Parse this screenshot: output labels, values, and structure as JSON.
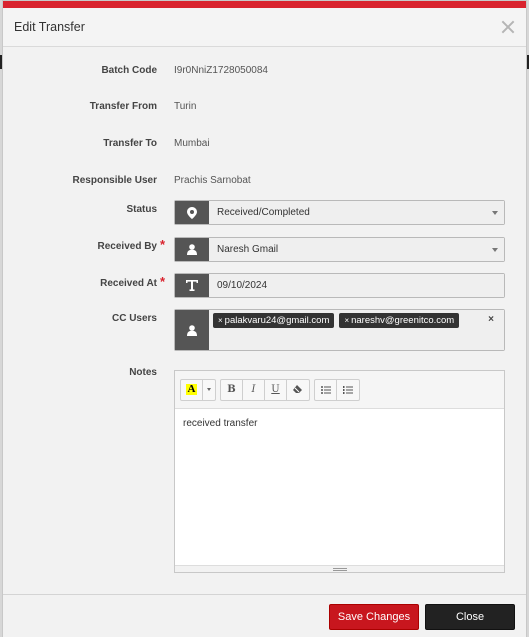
{
  "modal": {
    "title": "Edit Transfer",
    "accent_color": "#d9232e"
  },
  "fields": {
    "batch_code": {
      "label": "Batch Code",
      "value": "I9r0NniZ1728050084"
    },
    "transfer_from": {
      "label": "Transfer From",
      "value": "Turin"
    },
    "transfer_to": {
      "label": "Transfer To",
      "value": "Mumbai"
    },
    "responsible_user": {
      "label": "Responsible User",
      "value": "Prachis Sarnobat"
    },
    "status": {
      "label": "Status",
      "value": "Received/Completed",
      "icon": "map-marker-icon"
    },
    "received_by": {
      "label": "Received By",
      "required_mark": "*",
      "value": "Naresh Gmail",
      "icon": "user-icon"
    },
    "received_at": {
      "label": "Received At",
      "required_mark": "*",
      "value": "09/10/2024",
      "icon": "text-icon"
    },
    "cc_users": {
      "label": "CC Users",
      "icon": "user-icon",
      "chip_remove": "×",
      "clear_all": "×",
      "chips": [
        "palakvaru24@gmail.com",
        "nareshv@greenitco.com"
      ]
    },
    "notes": {
      "label": "Notes",
      "content": "received transfer",
      "toolbar": {
        "color_label": "A",
        "bold": "B",
        "italic": "I",
        "underline": "U"
      }
    }
  },
  "footer": {
    "save_label": "Save Changes",
    "close_label": "Close"
  }
}
